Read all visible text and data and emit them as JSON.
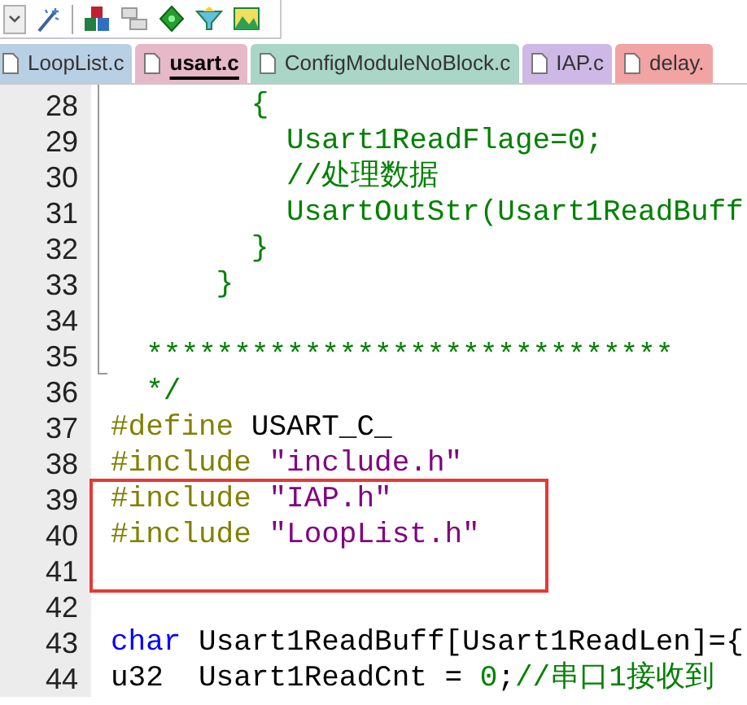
{
  "tabs": [
    {
      "label": "LoopList.c",
      "selected": false,
      "color": "#b9cfe3"
    },
    {
      "label": "usart.c",
      "selected": true,
      "color": "#e6b9c8"
    },
    {
      "label": "ConfigModuleNoBlock.c",
      "selected": false,
      "color": "#a9d6c6"
    },
    {
      "label": "IAP.c",
      "selected": false,
      "color": "#cdb8e6"
    },
    {
      "label": "delay.",
      "selected": false,
      "color": "#f2a3a3"
    }
  ],
  "lines": [
    {
      "number": "28",
      "highlight": false,
      "tokens": [
        {
          "kind": "comment",
          "text": "        {"
        }
      ]
    },
    {
      "number": "29",
      "highlight": false,
      "tokens": [
        {
          "kind": "comment",
          "text": "          Usart1ReadFlage=0;"
        }
      ]
    },
    {
      "number": "30",
      "highlight": false,
      "tokens": [
        {
          "kind": "comment",
          "text": "          //处理数据"
        }
      ]
    },
    {
      "number": "31",
      "highlight": false,
      "tokens": [
        {
          "kind": "comment",
          "text": "          UsartOutStr(Usart1ReadBuff"
        }
      ]
    },
    {
      "number": "32",
      "highlight": false,
      "tokens": [
        {
          "kind": "comment",
          "text": "        }"
        }
      ]
    },
    {
      "number": "33",
      "highlight": false,
      "tokens": [
        {
          "kind": "comment",
          "text": "      }"
        }
      ]
    },
    {
      "number": "34",
      "highlight": false
    },
    {
      "number": "35",
      "highlight": false,
      "tokens": [
        {
          "kind": "comment",
          "text": "  ******************************"
        }
      ]
    },
    {
      "number": "36",
      "highlight": false,
      "tokens": [
        {
          "kind": "comment",
          "text": "  */"
        }
      ]
    },
    {
      "number": "37",
      "highlight": false,
      "tokens": [
        {
          "kind": "preprocessor",
          "text": "#define"
        },
        {
          "kind": "plain",
          "text": " USART_C_"
        }
      ]
    },
    {
      "number": "38",
      "highlight": false,
      "tokens": [
        {
          "kind": "preprocessor",
          "text": "#include"
        },
        {
          "kind": "string",
          "text": " \"include.h\""
        }
      ]
    },
    {
      "number": "39",
      "highlight": true,
      "tokens": [
        {
          "kind": "preprocessor",
          "text": "#include"
        },
        {
          "kind": "string",
          "text": " \"IAP.h\""
        }
      ]
    },
    {
      "number": "40",
      "highlight": true,
      "tokens": [
        {
          "kind": "preprocessor",
          "text": "#include"
        },
        {
          "kind": "string",
          "text": " \"LoopList.h\""
        }
      ]
    },
    {
      "number": "41",
      "highlight": true
    },
    {
      "number": "42",
      "highlight": false
    },
    {
      "number": "43",
      "highlight": false,
      "tokens": [
        {
          "kind": "keyword",
          "text": "char"
        },
        {
          "kind": "plain",
          "text": " Usart1ReadBuff[Usart1ReadLen]={"
        }
      ]
    },
    {
      "number": "44",
      "highlight": false,
      "tokens": [
        {
          "kind": "plain",
          "text": "u32  Usart1ReadCnt = "
        },
        {
          "kind": "number",
          "text": "0"
        },
        {
          "kind": "plain",
          "text": ";"
        },
        {
          "kind": "comment",
          "text": "//串口1接收到"
        }
      ]
    }
  ]
}
